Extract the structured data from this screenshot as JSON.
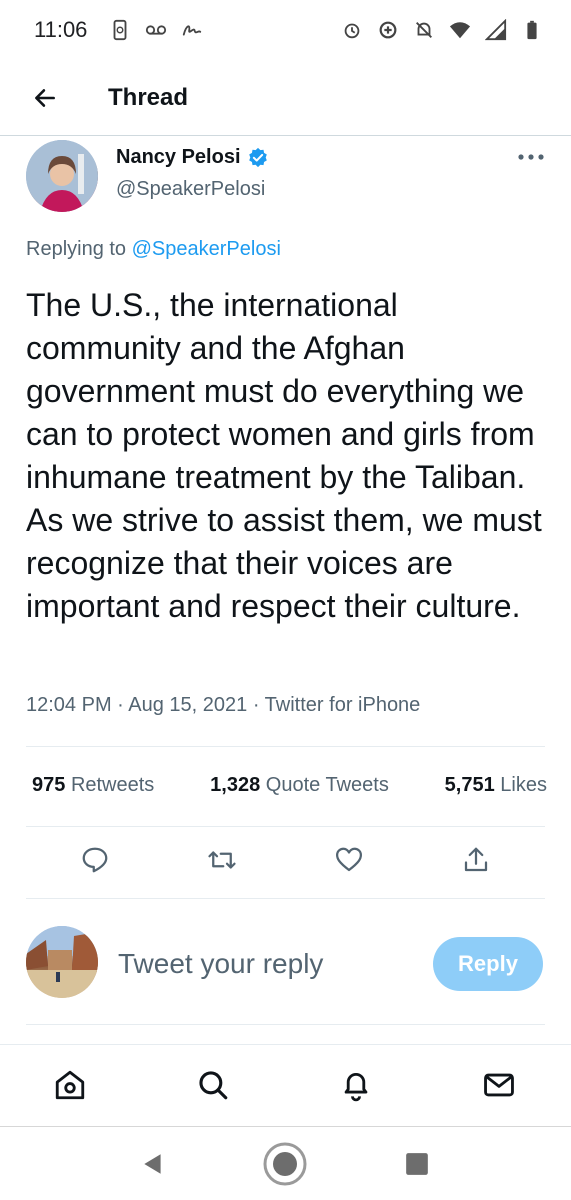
{
  "status_bar": {
    "time": "11:06",
    "left_icons": [
      "phone-sync-icon",
      "voicemail-icon",
      "signature-icon"
    ],
    "right_icons": [
      "alarm-icon",
      "data-saver-icon",
      "bell-off-icon",
      "wifi-icon",
      "signal-icon",
      "battery-icon"
    ]
  },
  "header": {
    "title": "Thread",
    "back_icon": "back-arrow-icon"
  },
  "tweet": {
    "author_name": "Nancy Pelosi",
    "author_handle": "@SpeakerPelosi",
    "verified": true,
    "replying_prefix": "Replying to",
    "replying_to": "@SpeakerPelosi",
    "text": "The U.S., the international community and the Afghan government must do everything we can to protect women and girls from inhumane treatment by the Taliban. As we strive to assist them, we must recognize that their voices are important and respect their culture.",
    "meta": "12:04 PM · Aug 15, 2021 · Twitter for iPhone"
  },
  "stats": {
    "retweets_count": "975",
    "retweets_label": "Retweets",
    "quotes_count": "1,328",
    "quotes_label": "Quote Tweets",
    "likes_count": "5,751",
    "likes_label": "Likes"
  },
  "actions": [
    "reply-icon",
    "retweet-icon",
    "like-icon",
    "share-icon"
  ],
  "reply_bar": {
    "placeholder": "Tweet your reply",
    "button_label": "Reply"
  },
  "bottom_nav": [
    "home-icon",
    "search-icon",
    "notifications-icon",
    "messages-icon"
  ],
  "colors": {
    "accent": "#1d9bf0",
    "reply_button_disabled": "#8ecdf8",
    "secondary_text": "#536471",
    "primary_text": "#0f1419"
  }
}
